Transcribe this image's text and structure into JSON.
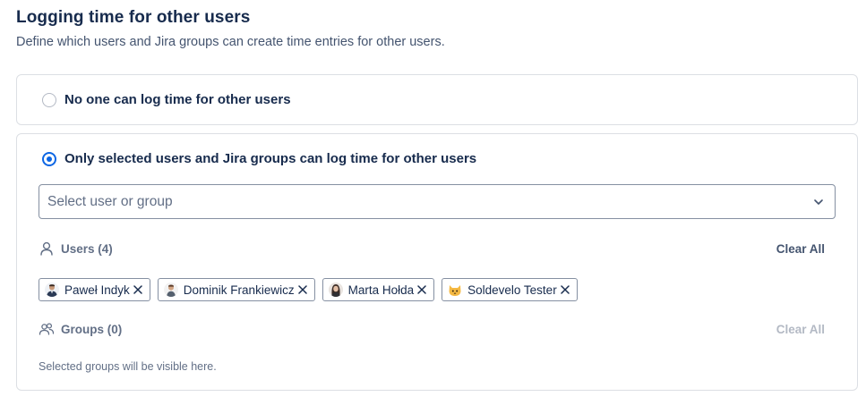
{
  "header": {
    "title": "Logging time for other users",
    "subtitle": "Define which users and Jira groups can create time entries for other users."
  },
  "options": {
    "none": {
      "label": "No one can log time for other users",
      "selected": false
    },
    "selected": {
      "label": "Only selected users and Jira groups can log time for other users",
      "selected": true
    }
  },
  "select": {
    "placeholder": "Select user or group"
  },
  "users": {
    "label": "Users (4)",
    "clear_label": "Clear All",
    "items": [
      {
        "name": "Paweł Indyk",
        "avatar": "avatar-man-suit"
      },
      {
        "name": "Dominik Frankiewicz",
        "avatar": "avatar-man"
      },
      {
        "name": "Marta Hołda",
        "avatar": "avatar-woman"
      },
      {
        "name": "Soldevelo Tester",
        "avatar": "avatar-cat"
      }
    ]
  },
  "groups": {
    "label": "Groups (0)",
    "clear_label": "Clear All",
    "empty_text": "Selected groups will be visible here."
  },
  "colors": {
    "accent": "#0c66e4",
    "text": "#172b4d",
    "subtle": "#626f86",
    "border": "#dcdfe4"
  }
}
